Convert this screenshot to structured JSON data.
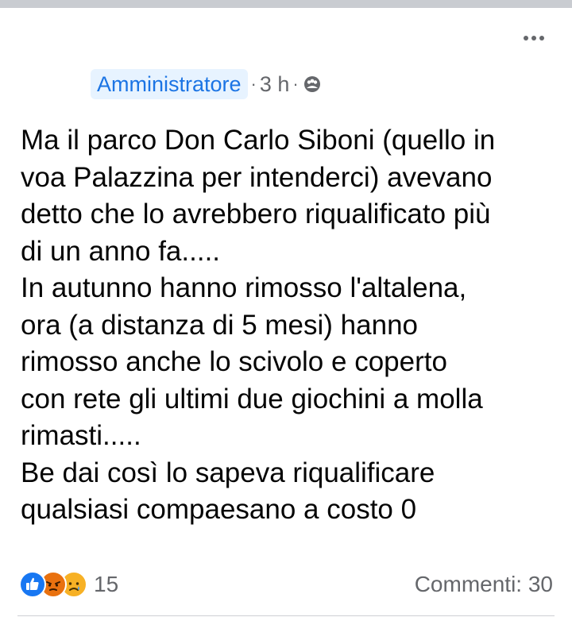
{
  "post": {
    "meta": {
      "role_badge": "Amministratore",
      "separator": "·",
      "time": "3 h",
      "privacy_icon": "group-privacy-icon"
    },
    "text_lines": [
      "Ma il parco Don Carlo Siboni (quello in",
      "voa Palazzina per intenderci) avevano",
      "detto che lo avrebbero riqualificato più",
      "di un anno fa.....",
      "In autunno hanno rimosso l'altalena,",
      "ora (a distanza di 5 mesi) hanno",
      "rimosso anche lo scivolo e coperto",
      "con rete gli ultimi due giochini a molla",
      "rimasti.....",
      "Be dai così lo sapeva riqualificare",
      "qualsiasi compaesano a costo 0"
    ],
    "reactions": {
      "icons": [
        "like-icon",
        "angry-icon",
        "sad-icon"
      ],
      "count": "15"
    },
    "comments_label": "Commenti: 30"
  },
  "colors": {
    "badge_bg": "#e7f3ff",
    "badge_text": "#1b74e4",
    "secondary_text": "#65676b",
    "like_blue": "#1877f2",
    "angry_orange": "#e9710f",
    "sad_yellow": "#f7b125"
  }
}
